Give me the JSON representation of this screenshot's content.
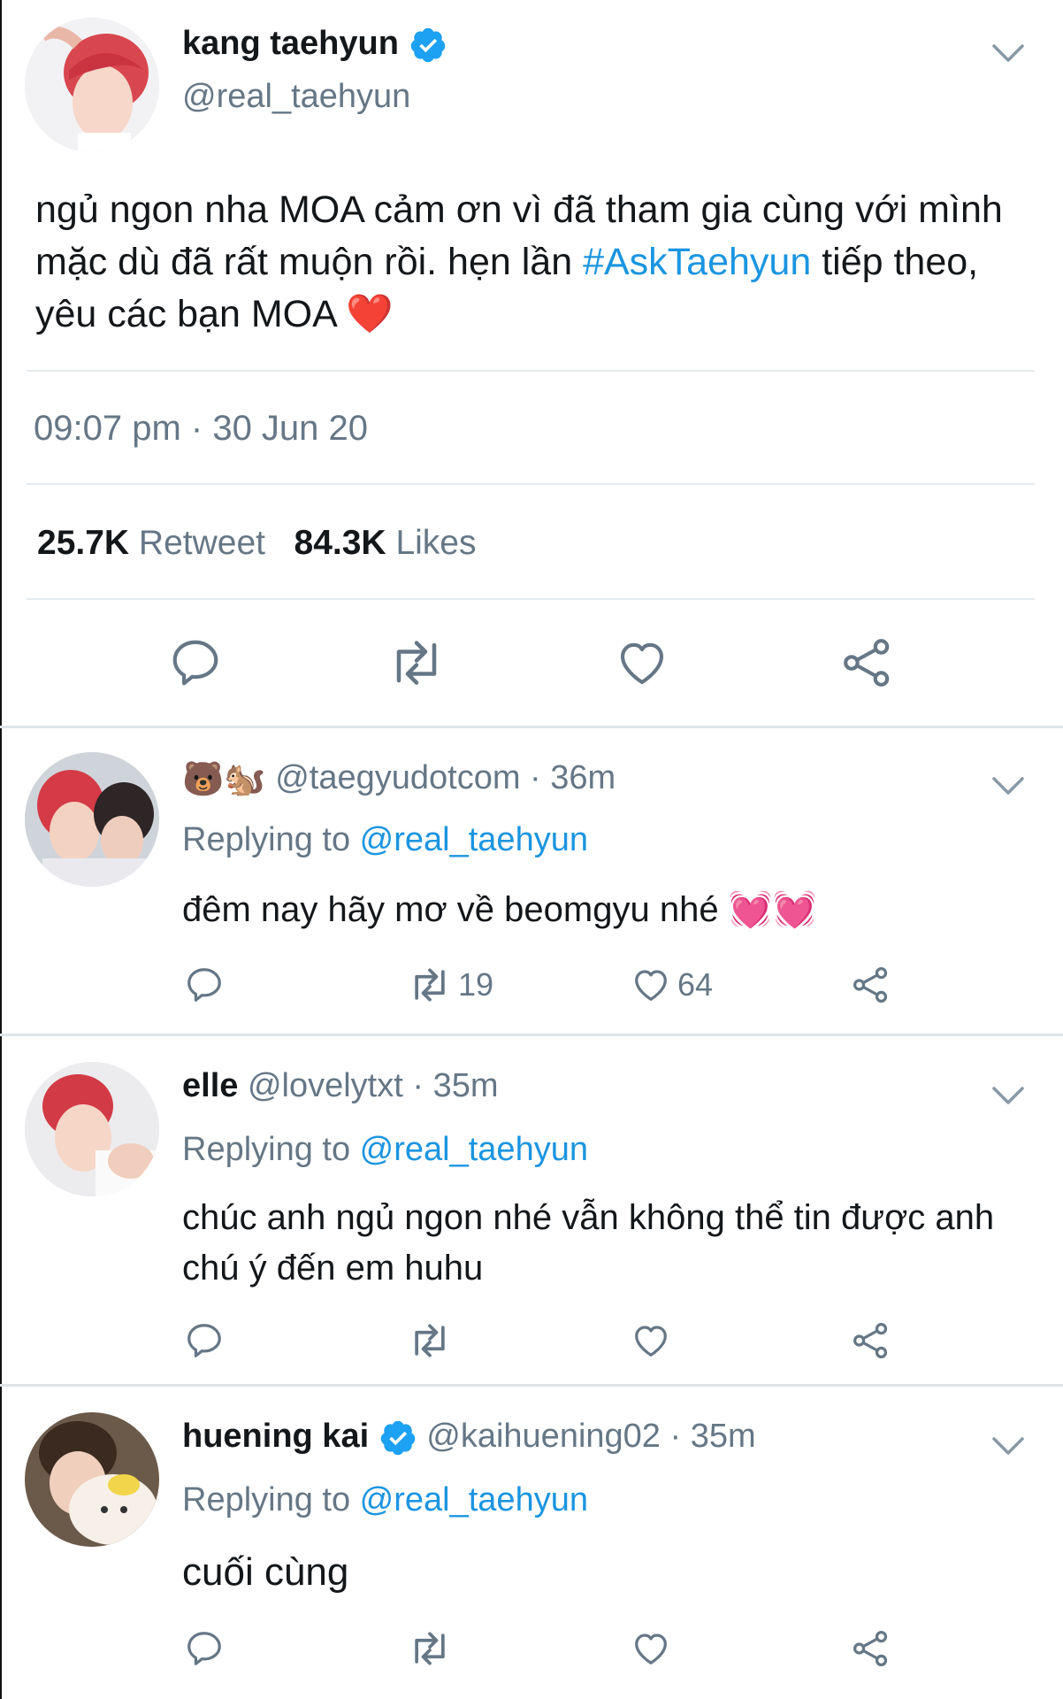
{
  "main_tweet": {
    "display_name": "kang taehyun",
    "handle": "@real_taehyun",
    "text_part1": "ngủ ngon nha MOA cảm ơn vì đã tham gia cùng với mình mặc dù đã rất muộn rồi. hẹn lần ",
    "hashtag": "#AskTaehyun",
    "text_part2": " tiếp theo, yêu các bạn MOA ",
    "heart_emoji": "❤️",
    "timestamp": "09:07 pm · 30 Jun 20",
    "retweet_count": "25.7K",
    "retweet_label": "Retweet",
    "likes_count": "84.3K",
    "likes_label": "Likes",
    "actions": [
      "reply-icon",
      "retweet-icon",
      "like-icon",
      "share-icon"
    ]
  },
  "replies": [
    {
      "emoji_name": "🐻🐿️",
      "display_name": "",
      "handle": "@taegyudotcom",
      "time": "· 36m",
      "replying_label": "Replying to ",
      "replying_to": "@real_taehyun",
      "text": "đêm nay hãy mơ về beomgyu nhé 💓💓",
      "retweets": "19",
      "likes": "64"
    },
    {
      "display_name": "elle",
      "handle": "@lovelytxt",
      "time": "· 35m",
      "replying_label": "Replying to ",
      "replying_to": "@real_taehyun",
      "text": "chúc anh ngủ ngon nhé vẫn không thể tin được anh chú ý đến em huhu",
      "retweets": "",
      "likes": ""
    },
    {
      "display_name": "huening kai",
      "handle": "@kaihuening02",
      "time": "· 35m",
      "replying_label": "Replying to ",
      "replying_to": "@real_taehyun",
      "text": "cuối cùng",
      "retweets": "",
      "likes": ""
    }
  ],
  "colors": {
    "link": "#1b95e0",
    "verified": "#1da1f2",
    "muted": "#657786",
    "heart": "#e0245e"
  }
}
